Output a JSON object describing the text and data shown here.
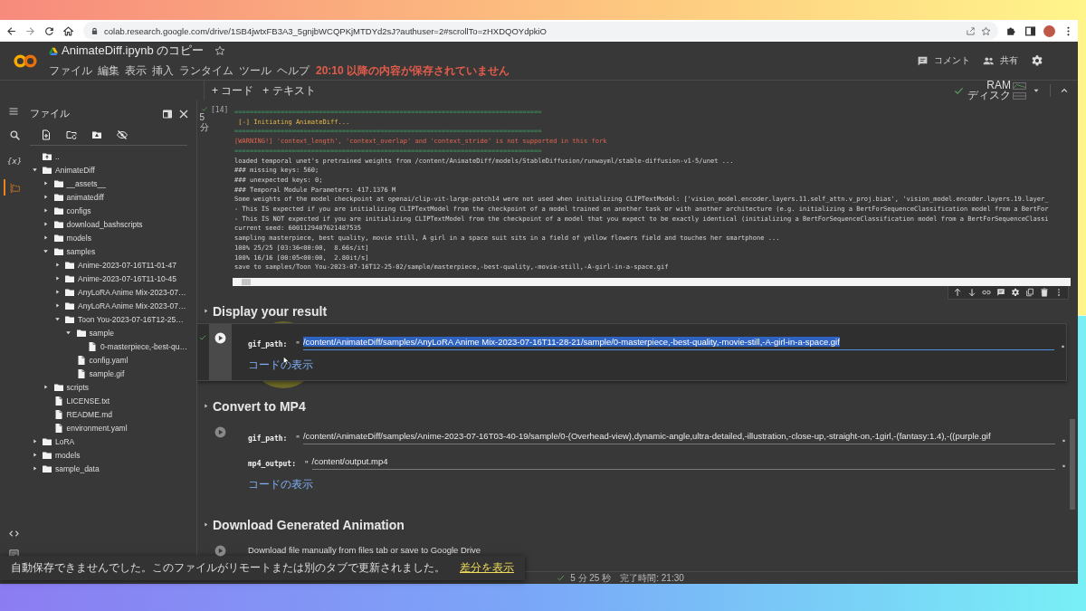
{
  "browser": {
    "url": "colab.research.google.com/drive/1SB4jwtxFB3A3_5gnjbWCQPKjMTDYd2sJ?authuser=2#scrollTo=zHXDQOYdpkiO",
    "bookmarked": false
  },
  "notebook": {
    "title": "AnimateDiff.ipynb のコピー",
    "starred": false,
    "menus": [
      "ファイル",
      "編集",
      "表示",
      "挿入",
      "ランタイム",
      "ツール",
      "ヘルプ"
    ],
    "unsaved_notice": "20:10 以降の内容が保存されていません",
    "actions": [
      {
        "kind": "comment",
        "label": "コメント"
      },
      {
        "kind": "share",
        "label": "共有"
      }
    ]
  },
  "toolbar": {
    "add_buttons": [
      "+ コード",
      "+ テキスト"
    ],
    "connected": true,
    "ram_label": "RAM",
    "disk_label": "ディスク"
  },
  "sidebar": {
    "title": "ファイル",
    "rail": [
      {
        "kind": "search",
        "selected": false
      },
      {
        "kind": "variables",
        "glyph": "{x}",
        "selected": false
      },
      {
        "kind": "files",
        "selected": true
      }
    ],
    "tree": [
      {
        "kind": "up",
        "label": ".."
      },
      {
        "kind": "folder",
        "label": "AnimateDiff",
        "expanded": true,
        "children": [
          {
            "kind": "folder",
            "label": "__assets__",
            "expanded": false
          },
          {
            "kind": "folder",
            "label": "animatediff",
            "expanded": false
          },
          {
            "kind": "folder",
            "label": "configs",
            "expanded": false
          },
          {
            "kind": "folder",
            "label": "download_bashscripts",
            "expanded": false
          },
          {
            "kind": "folder",
            "label": "models",
            "expanded": false
          },
          {
            "kind": "folder",
            "label": "samples",
            "expanded": true,
            "children": [
              {
                "kind": "folder",
                "label": "Anime-2023-07-16T11-01-47",
                "expanded": false
              },
              {
                "kind": "folder",
                "label": "Anime-2023-07-16T11-10-45",
                "expanded": false
              },
              {
                "kind": "folder",
                "label": "AnyLoRA Anime Mix-2023-07…",
                "expanded": false
              },
              {
                "kind": "folder",
                "label": "AnyLoRA Anime Mix-2023-07…",
                "expanded": false
              },
              {
                "kind": "folder",
                "label": "Toon You-2023-07-16T12-25…",
                "expanded": true,
                "children": [
                  {
                    "kind": "folder",
                    "label": "sample",
                    "expanded": true,
                    "children": [
                      {
                        "kind": "file",
                        "label": "0-masterpiece,-best-qu…"
                      }
                    ]
                  },
                  {
                    "kind": "file",
                    "label": "config.yaml"
                  },
                  {
                    "kind": "file",
                    "label": "sample.gif"
                  }
                ]
              }
            ]
          },
          {
            "kind": "folder",
            "label": "scripts",
            "expanded": false
          },
          {
            "kind": "file",
            "label": "LICENSE.txt"
          },
          {
            "kind": "file",
            "label": "README.md"
          },
          {
            "kind": "file",
            "label": "environment.yaml"
          }
        ]
      },
      {
        "kind": "folder",
        "label": "LoRA",
        "expanded": false
      },
      {
        "kind": "folder",
        "label": "models",
        "expanded": false
      },
      {
        "kind": "folder",
        "label": "sample_data",
        "expanded": false
      }
    ]
  },
  "output_cell": {
    "done": true,
    "duration": "5 分",
    "count": "[14]",
    "lines": [
      {
        "kind": "rule",
        "text": "================================================================================"
      },
      {
        "kind": "info",
        "text": " [-] Initiating AnimateDiff..."
      },
      {
        "kind": "rule",
        "text": "================================================================================"
      },
      {
        "kind": "warning",
        "text": "[WARNING!] 'context_length', 'context_overlap' and 'context_stride' is not supported in this fork"
      },
      {
        "kind": "rule",
        "text": "================================================================================"
      },
      {
        "kind": "plain",
        "text": "loaded temporal unet's pretrained weights from /content/AnimateDiff/models/StableDiffusion/runwayml/stable-diffusion-v1-5/unet ..."
      },
      {
        "kind": "plain",
        "text": "### missing keys: 560;"
      },
      {
        "kind": "plain",
        "text": "### unexpected keys: 0;"
      },
      {
        "kind": "plain",
        "text": "### Temporal Module Parameters: 417.1376 M"
      },
      {
        "kind": "plain",
        "text": "Some weights of the model checkpoint at openai/clip-vit-large-patch14 were not used when initializing CLIPTextModel: ['vision_model.encoder.layers.11.self_attn.v_proj.bias', 'vision_model.encoder.layers.19.layer_"
      },
      {
        "kind": "plain",
        "text": "- This IS expected if you are initializing CLIPTextModel from the checkpoint of a model trained on another task or with another architecture (e.g. initializing a BertForSequenceClassification model from a BertFor"
      },
      {
        "kind": "plain",
        "text": "- This IS NOT expected if you are initializing CLIPTextModel from the checkpoint of a model that you expect to be exactly identical (initializing a BertForSequenceClassification model from a BertForSequenceClassi"
      },
      {
        "kind": "plain",
        "text": "current seed: 6001129407621487535"
      },
      {
        "kind": "plain",
        "text": "sampling masterpiece, best quality, movie still, A girl in a space suit sits in a field of yellow flowers field and touches her smartphone ..."
      },
      {
        "kind": "plain",
        "text": "100% 25/25 [03:36<00:00,  8.66s/it]"
      },
      {
        "kind": "plain",
        "text": "100% 16/16 [00:05<00:00,  2.80it/s]"
      },
      {
        "kind": "plain",
        "text": "save to samples/Toon You-2023-07-16T12-25-02/sample/masterpiece,-best-quality,-movie-still,-A-girl-in-a-space.gif"
      }
    ]
  },
  "sections": [
    {
      "heading": "Display your result",
      "cell": {
        "focused": true,
        "done": true,
        "fields": [
          {
            "label": "gif_path:",
            "quote": "\"",
            "value": "/content/AnimateDiff/samples/AnyLoRA Anime Mix-2023-07-16T11-28-21/sample/0-masterpiece,-best-quality,-movie-still,-A-girl-in-a-space.gif",
            "highlighted": true
          }
        ],
        "link": "コードの表示"
      }
    },
    {
      "heading": "Convert to MP4",
      "cell": {
        "focused": false,
        "done": false,
        "fields": [
          {
            "label": "gif_path:",
            "quote": "\"",
            "value": "/content/AnimateDiff/samples/Anime-2023-07-16T03-40-19/sample/0-(Overhead-view),dynamic-angle,ultra-detailed,-illustration,-close-up,-straight-on,-1girl,-(fantasy:1.4),-((purple.gif",
            "highlighted": false
          },
          {
            "label": "mp4_output:",
            "quote": "\"",
            "value": "/content/output.mp4",
            "highlighted": false
          }
        ],
        "link": "コードの表示"
      }
    },
    {
      "heading": "Download Generated Animation",
      "cell": {
        "focused": false,
        "done": false,
        "text": "Download file manually from files tab or save to Google Drive"
      }
    }
  ],
  "snackbar": {
    "message": "自動保存できませんでした。このファイルがリモートまたは別のタブで更新されました。",
    "link": "差分を表示"
  },
  "status_bar": {
    "done": true,
    "elapsed": "5 分 25 秒",
    "finished": "完了時間: 21:30"
  }
}
